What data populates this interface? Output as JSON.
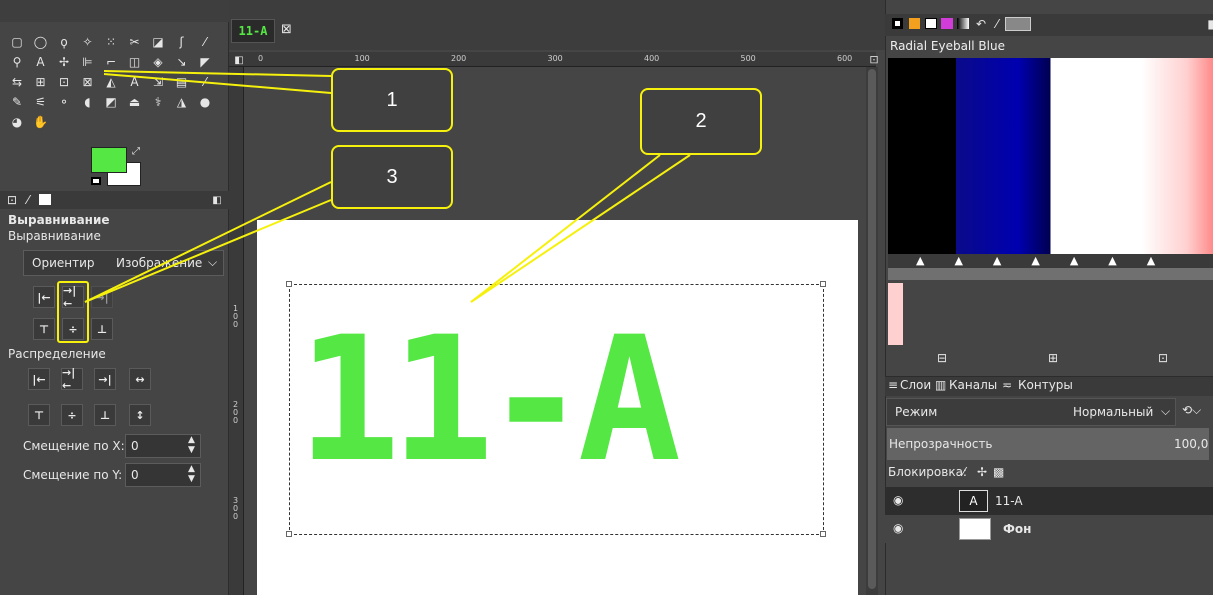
{
  "image_tab": {
    "label": "11-A",
    "close": "⊠"
  },
  "ruler": {
    "h_ticks": [
      "0",
      "100",
      "200",
      "300",
      "400",
      "500",
      "600"
    ],
    "v_ticks": [
      "100",
      "200",
      "300"
    ]
  },
  "canvas": {
    "text": "11-A"
  },
  "align_panel": {
    "title": "Выравнивание",
    "subtitle": "Выравнивание",
    "relative_label": "Ориентир",
    "relative_value": "Изображение",
    "distribution_label": "Распределение",
    "offset_x_label": "Смещение по X:",
    "offset_x_value": "0",
    "offset_y_label": "Смещение по Y:",
    "offset_y_value": "0"
  },
  "gradient": {
    "name": "Radial Eyeball Blue"
  },
  "layers_panel": {
    "tabs": [
      "Слои",
      "Каналы",
      "Контуры"
    ],
    "mode_label": "Режим",
    "mode_value": "Нормальный",
    "opacity_label": "Непрозрачность",
    "opacity_value": "100,0",
    "lock_label": "Блокировка:",
    "layers": [
      {
        "name": "11-A",
        "selected": true
      },
      {
        "name": "Фон",
        "selected": false
      }
    ]
  },
  "callouts": [
    "1",
    "2",
    "3"
  ],
  "colors": {
    "foreground": "#55e844",
    "background": "#ffffff",
    "highlight": "#f6f10c",
    "text_color": "#55e844"
  }
}
